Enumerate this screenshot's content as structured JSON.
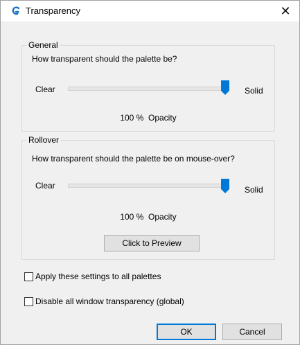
{
  "window": {
    "title": "Transparency",
    "close_glyph": "✕"
  },
  "general": {
    "group_label": "General",
    "question": "How transparent should the palette be?",
    "clear_label": "Clear",
    "solid_label": "Solid",
    "opacity_percent": "100 %",
    "opacity_word": "Opacity",
    "slider_value": 1.0
  },
  "rollover": {
    "group_label": "Rollover",
    "question": "How transparent should the palette be on mouse-over?",
    "clear_label": "Clear",
    "solid_label": "Solid",
    "opacity_percent": "100 %",
    "opacity_word": "Opacity",
    "slider_value": 1.0,
    "preview_button": "Click to Preview"
  },
  "options": {
    "apply_all": {
      "label": "Apply these settings to all palettes",
      "checked": false
    },
    "disable_all": {
      "label": "Disable all window transparency (global)",
      "checked": false
    }
  },
  "buttons": {
    "ok": "OK",
    "cancel": "Cancel"
  },
  "colors": {
    "accent": "#0078d7",
    "dialog_bg": "#f0f0f0",
    "thumb": "#0078d7"
  },
  "icons": {
    "app": "app-logo-icon",
    "close": "close-icon"
  }
}
